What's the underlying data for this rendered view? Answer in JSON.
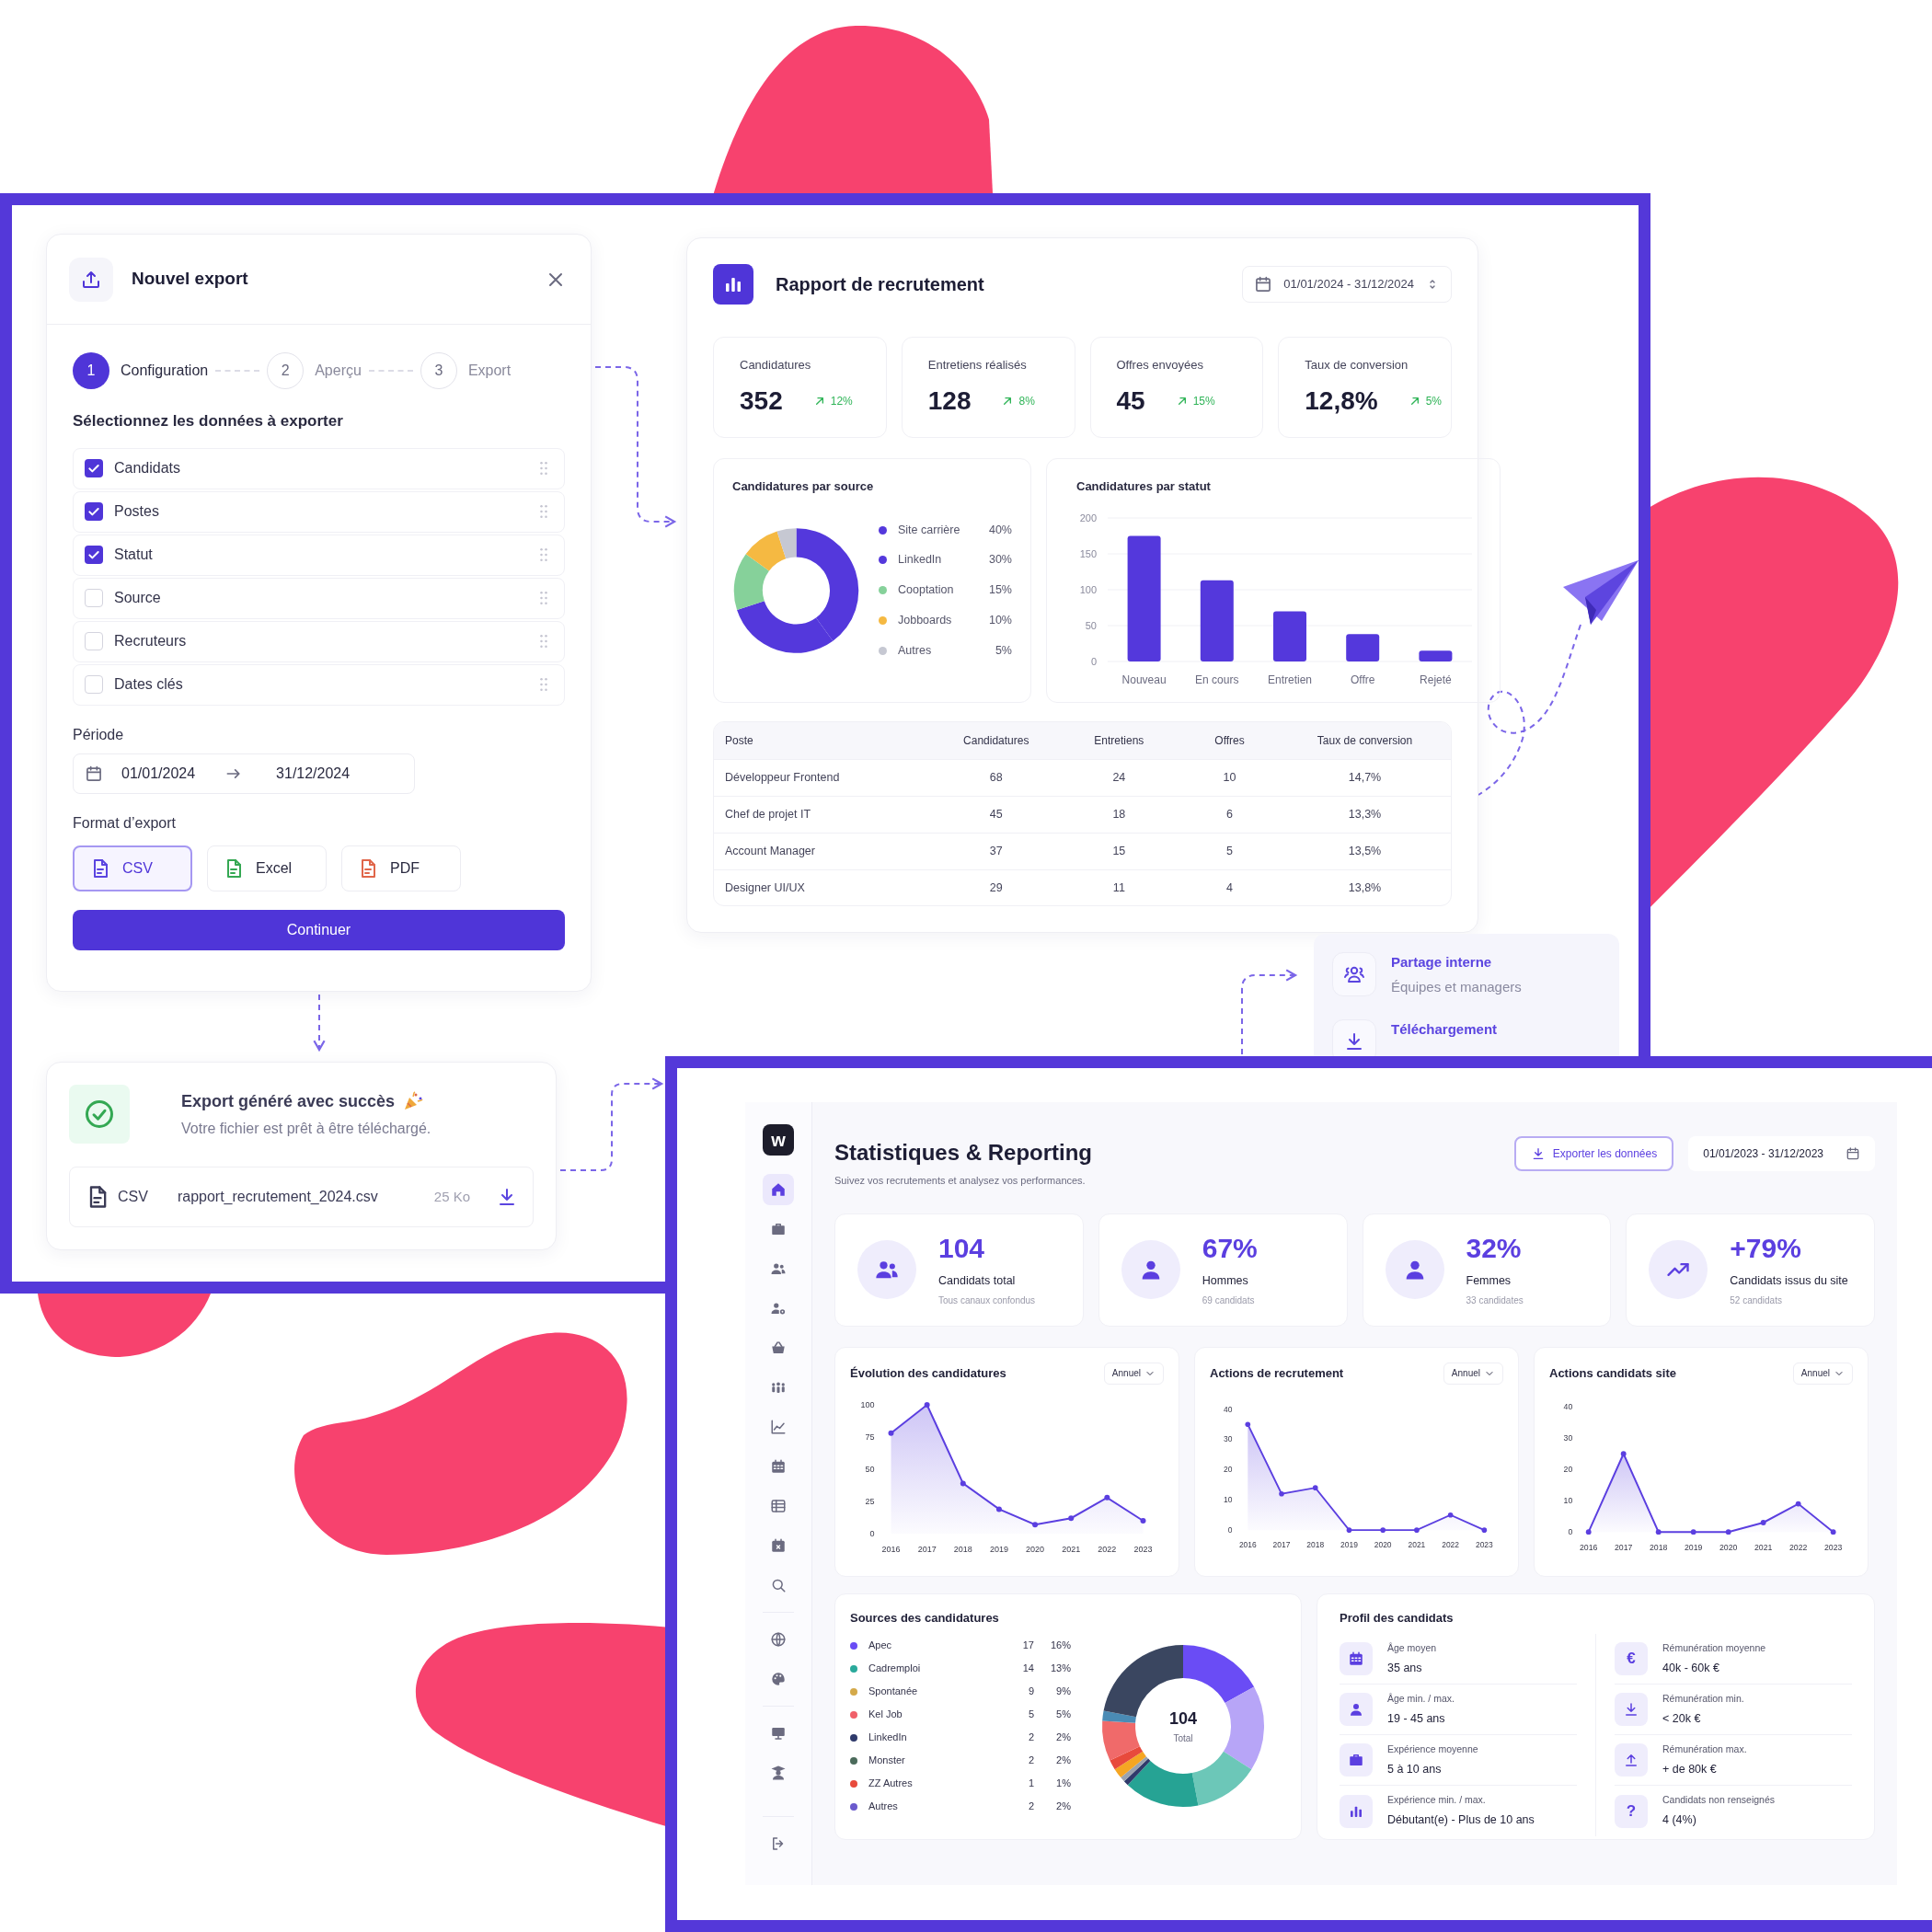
{
  "export_dialog": {
    "title": "Nouvel export",
    "steps": [
      {
        "number": "1",
        "label": "Configuration",
        "selected": true
      },
      {
        "number": "2",
        "label": "Aperçu",
        "selected": false
      },
      {
        "number": "3",
        "label": "Export",
        "selected": false
      }
    ],
    "section_title": "Sélectionnez les données à exporter",
    "fields": [
      {
        "label": "Candidats",
        "checked": true
      },
      {
        "label": "Postes",
        "checked": true
      },
      {
        "label": "Statut",
        "checked": true
      },
      {
        "label": "Source",
        "checked": false
      },
      {
        "label": "Recruteurs",
        "checked": false
      },
      {
        "label": "Dates clés",
        "checked": false
      }
    ],
    "period": {
      "label": "Période",
      "start": "01/01/2024",
      "end": "31/12/2024"
    },
    "format": {
      "label": "Format d’export",
      "options": [
        {
          "label": "CSV",
          "selected": true,
          "color": "#5b45e0"
        },
        {
          "label": "Excel",
          "selected": false,
          "color": "#35a853"
        },
        {
          "label": "PDF",
          "selected": false,
          "color": "#e0664a"
        }
      ]
    },
    "continue_button": "Continuer"
  },
  "export_success": {
    "title": "Export généré avec succès",
    "message": "Votre fichier est prêt à être téléchargé.",
    "file": {
      "type": "CSV",
      "name": "rapport_recrutement_2024.csv",
      "size": "25 Ko"
    }
  },
  "report": {
    "title": "Rapport de recrutement",
    "date_range": "01/01/2024 - 31/12/2024",
    "kpis": [
      {
        "label": "Candidatures",
        "value": "352",
        "trend": "12%"
      },
      {
        "label": "Entretiens réalisés",
        "value": "128",
        "trend": "8%"
      },
      {
        "label": "Offres envoyées",
        "value": "45",
        "trend": "15%"
      },
      {
        "label": "Taux de conversion",
        "value": "12,8%",
        "trend": "5%"
      }
    ],
    "source_chart": {
      "title": "Candidatures par source",
      "chart_data": {
        "type": "donut",
        "categories": [
          "Site carrière",
          "LinkedIn",
          "Cooptation",
          "Jobboards",
          "Autres"
        ],
        "values": [
          40,
          30,
          15,
          10,
          5
        ]
      },
      "legend": [
        {
          "color": "#5438dc",
          "share": "40%"
        },
        {
          "color": "#5438dc",
          "share": "30%"
        },
        {
          "color": "#86d19a",
          "share": "15%"
        },
        {
          "color": "#f5b942",
          "share": "10%"
        },
        {
          "color": "#c6c8d2",
          "share": "5%"
        }
      ]
    },
    "status_chart": {
      "title": "Candidatures par statut",
      "chart_data": {
        "type": "bar",
        "categories": [
          "Nouveau",
          "En cours",
          "Entretien",
          "Offre",
          "Rejeté"
        ],
        "series": [
          {
            "color": "#5438dc",
            "values": [
              175,
              113,
              70,
              38,
              15
            ]
          }
        ],
        "ylim": [
          0,
          200
        ],
        "yticks": [
          0,
          50,
          100,
          150,
          200
        ],
        "grid": true
      }
    },
    "table": {
      "columns": [
        "Poste",
        "Candidatures",
        "Entretiens",
        "Offres",
        "Taux de conversion"
      ],
      "rows": [
        [
          "Développeur Frontend",
          "68",
          "24",
          "10",
          "14,7%"
        ],
        [
          "Chef de projet IT",
          "45",
          "18",
          "6",
          "13,3%"
        ],
        [
          "Account Manager",
          "37",
          "15",
          "5",
          "13,5%"
        ],
        [
          "Designer UI/UX",
          "29",
          "11",
          "4",
          "13,8%"
        ]
      ]
    }
  },
  "sharing_panel": {
    "items": [
      {
        "kind": "users",
        "title": "Partage interne",
        "subtitle": "Équipes et managers"
      },
      {
        "kind": "download",
        "title": "Téléchargement"
      }
    ]
  },
  "dashboard": {
    "logo": "w",
    "nav_groups": [
      [
        {
          "kind": "home",
          "selected": true
        },
        {
          "kind": "briefcase",
          "selected": false
        },
        {
          "kind": "people",
          "selected": false
        },
        {
          "kind": "usercog",
          "selected": false
        },
        {
          "kind": "basket",
          "selected": false
        },
        {
          "kind": "crowd",
          "selected": false
        },
        {
          "kind": "chart",
          "selected": false
        },
        {
          "kind": "calendar",
          "selected": false
        },
        {
          "kind": "table",
          "selected": false
        },
        {
          "kind": "calx",
          "selected": false
        },
        {
          "kind": "search",
          "selected": false
        }
      ],
      [
        {
          "kind": "globe",
          "selected": false
        },
        {
          "kind": "palette",
          "selected": false
        }
      ],
      [
        {
          "kind": "monitor",
          "selected": false
        },
        {
          "kind": "graduate",
          "selected": false
        }
      ],
      [
        {
          "kind": "logout",
          "selected": false
        }
      ]
    ],
    "title": "Statistiques & Reporting",
    "subtitle": "Suivez vos recrutements et analysez vos performances.",
    "export_button": "Exporter les données",
    "date_range": "01/01/2023 - 31/12/2023",
    "kpis": [
      {
        "kind": "people",
        "value": "104",
        "label": "Candidats total",
        "note": "Tous canaux confondus"
      },
      {
        "kind": "user",
        "value": "67%",
        "label": "Hommes",
        "note": "69 candidats"
      },
      {
        "kind": "user",
        "value": "32%",
        "label": "Femmes",
        "note": "33 candidates"
      },
      {
        "kind": "trend",
        "value": "+79%",
        "label": "Candidats issus du site",
        "note": "52 candidats"
      }
    ],
    "charts": [
      {
        "title": "Évolution des candidatures",
        "period": "Annuel",
        "chart_data": {
          "type": "area",
          "categories": [
            "2016",
            "2017",
            "2018",
            "2019",
            "2020",
            "2021",
            "2022",
            "2023"
          ],
          "series": [
            {
              "color": "#5b3fe0",
              "values": [
                78,
                100,
                39,
                19,
                7,
                12,
                28,
                10
              ]
            }
          ],
          "ylim": [
            0,
            100
          ],
          "yticks": [
            0,
            25,
            50,
            75,
            100
          ]
        }
      },
      {
        "title": "Actions de recrutement",
        "period": "Annuel",
        "chart_data": {
          "type": "area",
          "categories": [
            "2016",
            "2017",
            "2018",
            "2019",
            "2020",
            "2021",
            "2022",
            "2023"
          ],
          "series": [
            {
              "color": "#5b3fe0",
              "values": [
                35,
                12,
                14,
                0,
                0,
                0,
                5,
                0
              ]
            }
          ],
          "ylim": [
            0,
            40
          ],
          "yticks": [
            0,
            10,
            20,
            30,
            40
          ]
        }
      },
      {
        "title": "Actions candidats site",
        "period": "Annuel",
        "chart_data": {
          "type": "area",
          "categories": [
            "2016",
            "2017",
            "2018",
            "2019",
            "2020",
            "2021",
            "2022",
            "2023"
          ],
          "series": [
            {
              "color": "#5b3fe0",
              "values": [
                0,
                25,
                0,
                0,
                0,
                3,
                9,
                0
              ]
            }
          ],
          "ylim": [
            0,
            40
          ],
          "yticks": [
            0,
            10,
            20,
            30,
            40
          ]
        }
      }
    ],
    "sources": {
      "title": "Sources des candidatures",
      "total": "104",
      "total_label": "Total",
      "items": [
        {
          "label": "Apec",
          "count": "17",
          "share": "16%",
          "color": "#6a4cf5"
        },
        {
          "label": "Cadremploi",
          "count": "14",
          "share": "13%",
          "color": "#2aa99b"
        },
        {
          "label": "Spontanée",
          "count": "9",
          "share": "9%",
          "color": "#d4a94a"
        },
        {
          "label": "Kel Job",
          "count": "5",
          "share": "5%",
          "color": "#f0606a"
        },
        {
          "label": "LinkedIn",
          "count": "2",
          "share": "2%",
          "color": "#2f3a6b"
        },
        {
          "label": "Monster",
          "count": "2",
          "share": "2%",
          "color": "#4b6b5b"
        },
        {
          "label": "ZZ Autres",
          "count": "1",
          "share": "1%",
          "color": "#e84a3c"
        },
        {
          "label": "Autres",
          "count": "2",
          "share": "2%",
          "color": "#6a5acd"
        }
      ]
    },
    "profile": {
      "title": "Profil des candidats",
      "columns": [
        [
          {
            "kind": "calendar",
            "label": "Âge moyen",
            "value": "35 ans"
          },
          {
            "kind": "user",
            "label": "Âge min. / max.",
            "value": "19 - 45 ans"
          },
          {
            "kind": "briefcase",
            "label": "Expérience moyenne",
            "value": "5 à 10 ans"
          },
          {
            "kind": "bars",
            "label": "Expérience min. / max.",
            "value": "Débutant(e) - Plus de 10 ans"
          }
        ],
        [
          {
            "kind": "glyph",
            "glyph": "€",
            "label": "Rémunération moyenne",
            "value": "40k - 60k €"
          },
          {
            "kind": "download",
            "label": "Rémunération min.",
            "value": "< 20k €"
          },
          {
            "kind": "upload",
            "label": "Rémunération max.",
            "value": "+ de 80k €"
          },
          {
            "kind": "glyph",
            "glyph": "?",
            "label": "Candidats non renseignés",
            "value": "4 (4%)"
          }
        ]
      ]
    }
  }
}
